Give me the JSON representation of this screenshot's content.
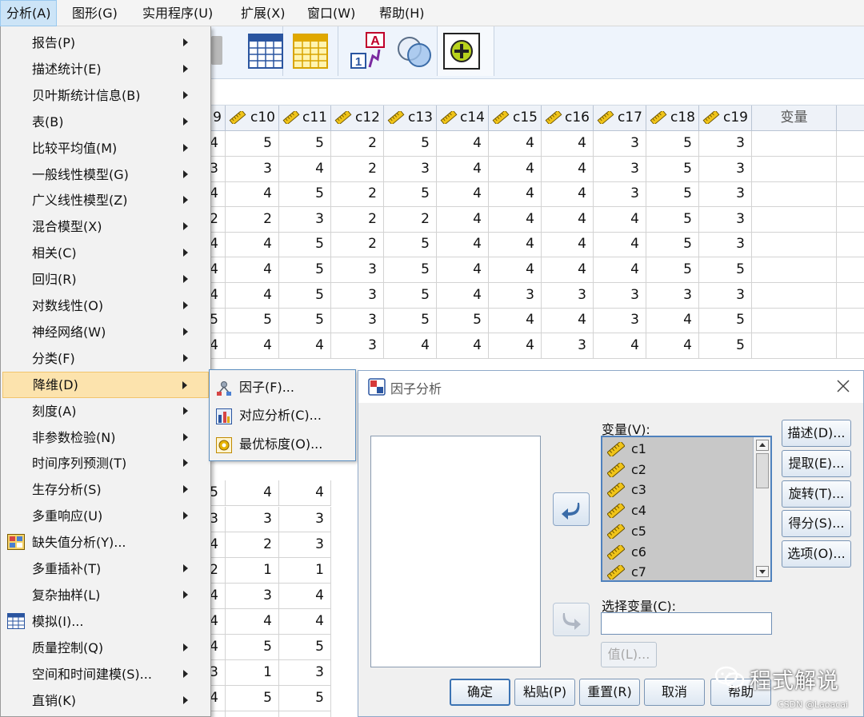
{
  "menubar": {
    "items": [
      "分析(A)",
      "图形(G)",
      "实用程序(U)",
      "扩展(X)",
      "窗口(W)",
      "帮助(H)"
    ],
    "active_index": 0
  },
  "analyze_menu": {
    "items": [
      {
        "label": "报告(P)",
        "submenu": true
      },
      {
        "label": "描述统计(E)",
        "submenu": true
      },
      {
        "label": "贝叶斯统计信息(B)",
        "submenu": true
      },
      {
        "label": "表(B)",
        "submenu": true
      },
      {
        "label": "比较平均值(M)",
        "submenu": true
      },
      {
        "label": "一般线性模型(G)",
        "submenu": true
      },
      {
        "label": "广义线性模型(Z)",
        "submenu": true
      },
      {
        "label": "混合模型(X)",
        "submenu": true
      },
      {
        "label": "相关(C)",
        "submenu": true
      },
      {
        "label": "回归(R)",
        "submenu": true
      },
      {
        "label": "对数线性(O)",
        "submenu": true
      },
      {
        "label": "神经网络(W)",
        "submenu": true
      },
      {
        "label": "分类(F)",
        "submenu": true
      },
      {
        "label": "降维(D)",
        "submenu": true,
        "highlighted": true
      },
      {
        "label": "刻度(A)",
        "submenu": true
      },
      {
        "label": "非参数检验(N)",
        "submenu": true
      },
      {
        "label": "时间序列预测(T)",
        "submenu": true
      },
      {
        "label": "生存分析(S)",
        "submenu": true
      },
      {
        "label": "多重响应(U)",
        "submenu": true
      },
      {
        "label": "缺失值分析(Y)...",
        "submenu": false,
        "icon": "missing-value-icon"
      },
      {
        "label": "多重插补(T)",
        "submenu": true
      },
      {
        "label": "复杂抽样(L)",
        "submenu": true
      },
      {
        "label": "模拟(I)...",
        "submenu": false,
        "icon": "simulation-icon"
      },
      {
        "label": "质量控制(Q)",
        "submenu": true
      },
      {
        "label": "空间和时间建模(S)...",
        "submenu": true
      },
      {
        "label": "直销(K)",
        "submenu": true
      }
    ]
  },
  "dim_reduction_submenu": {
    "items": [
      {
        "label": "因子(F)...",
        "icon": "factor-icon"
      },
      {
        "label": "对应分析(C)...",
        "icon": "correspondence-icon"
      },
      {
        "label": "最优标度(O)...",
        "icon": "optimal-scaling-icon"
      }
    ]
  },
  "grid": {
    "partial_first_header": "9",
    "headers": [
      "c10",
      "c11",
      "c12",
      "c13",
      "c14",
      "c15",
      "c16",
      "c17",
      "c18",
      "c19"
    ],
    "empty_header": "变量",
    "rows": [
      [
        "4",
        "5",
        "5",
        "2",
        "5",
        "4",
        "4",
        "4",
        "3",
        "5",
        "3"
      ],
      [
        "3",
        "3",
        "4",
        "2",
        "3",
        "4",
        "4",
        "4",
        "3",
        "5",
        "3"
      ],
      [
        "4",
        "4",
        "5",
        "2",
        "5",
        "4",
        "4",
        "4",
        "3",
        "5",
        "3"
      ],
      [
        "2",
        "2",
        "3",
        "2",
        "2",
        "4",
        "4",
        "4",
        "4",
        "5",
        "3"
      ],
      [
        "4",
        "4",
        "5",
        "2",
        "5",
        "4",
        "4",
        "4",
        "4",
        "5",
        "3"
      ],
      [
        "4",
        "4",
        "5",
        "3",
        "5",
        "4",
        "4",
        "4",
        "4",
        "5",
        "5"
      ],
      [
        "4",
        "4",
        "5",
        "3",
        "5",
        "4",
        "3",
        "3",
        "3",
        "3",
        "3"
      ],
      [
        "5",
        "5",
        "5",
        "3",
        "5",
        "5",
        "4",
        "4",
        "3",
        "4",
        "5"
      ],
      [
        "4",
        "4",
        "4",
        "3",
        "4",
        "4",
        "4",
        "3",
        "4",
        "4",
        "5"
      ]
    ],
    "lower_rows": [
      [
        "5",
        "4",
        "4"
      ],
      [
        "3",
        "3",
        "3"
      ],
      [
        "4",
        "2",
        "3"
      ],
      [
        "2",
        "1",
        "1"
      ],
      [
        "4",
        "3",
        "4"
      ],
      [
        "4",
        "4",
        "4"
      ],
      [
        "4",
        "5",
        "5"
      ],
      [
        "3",
        "1",
        "3"
      ],
      [
        "4",
        "5",
        "5"
      ],
      [
        "4",
        "4",
        "4"
      ]
    ]
  },
  "dialog": {
    "title": "因子分析",
    "variables_label": "变量(V):",
    "variables": [
      "c1",
      "c2",
      "c3",
      "c4",
      "c5",
      "c6",
      "c7"
    ],
    "selection_label": "选择变量(C):",
    "selection_value": "",
    "value_button": "值(L)...",
    "side_buttons": [
      "描述(D)...",
      "提取(E)...",
      "旋转(T)...",
      "得分(S)...",
      "选项(O)..."
    ],
    "bottom_buttons": [
      "确定",
      "粘贴(P)",
      "重置(R)",
      "取消",
      "帮助"
    ]
  },
  "watermark": {
    "text": "程式解说",
    "sub": "CSDN @Laoacai"
  },
  "colors": {
    "menu_highlight": "#fce3ad",
    "menubar_active": "#cce4f7",
    "dialog_border": "#8fa9c8"
  }
}
